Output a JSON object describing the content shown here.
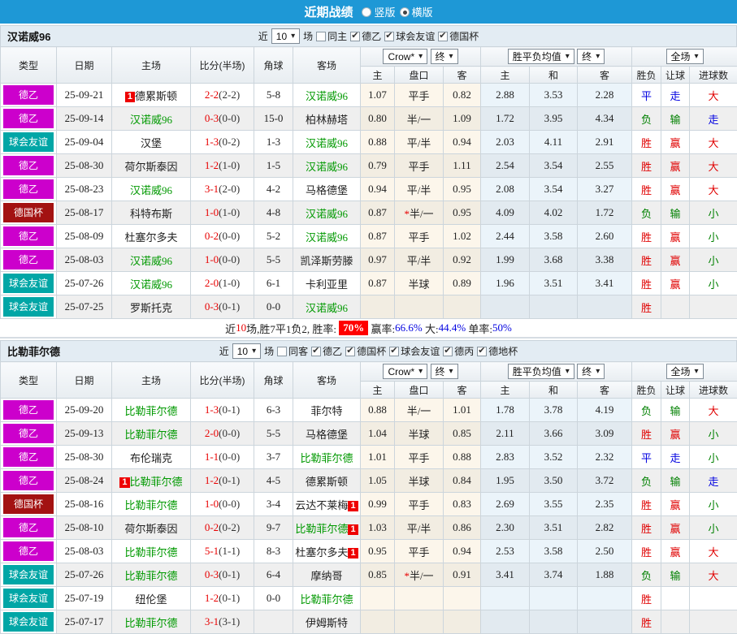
{
  "topbar": {
    "title": "近期战绩",
    "vertical_label": "竖版",
    "horizontal_label": "横版"
  },
  "config": {
    "badge_text": "1"
  },
  "colors": {
    "type_bg": {
      "德乙": "#cc00cc",
      "球会友谊": "#01a6a6",
      "德国杯": "#a31212"
    },
    "result": {
      "胜": "#e00000",
      "赢": "#e00000",
      "大": "#e00000",
      "平": "#0000e0",
      "走": "#0000e0",
      "负": "#008000",
      "输": "#008000",
      "小": "#008000"
    }
  },
  "table_header": {
    "cols": [
      "类型",
      "日期",
      "主场",
      "比分(半场)",
      "角球",
      "客场"
    ],
    "group1_select": "Crow*",
    "group1_final": "终",
    "group1_cols": [
      "主",
      "盘口",
      "客"
    ],
    "group2_select": "胜平负均值",
    "group2_final": "终",
    "group2_cols": [
      "主",
      "和",
      "客"
    ],
    "group3_select": "全场",
    "group3_cols": [
      "胜负",
      "让球",
      "进球数"
    ]
  },
  "sections": [
    {
      "team": "汉诺威96",
      "controls": {
        "prefix": "近",
        "count": "10",
        "suffix": "场",
        "same_label": "同主",
        "same_checked": false,
        "leagues": [
          {
            "label": "德乙",
            "checked": true
          },
          {
            "label": "球会友谊",
            "checked": true
          },
          {
            "label": "德国杯",
            "checked": true
          }
        ]
      },
      "rows": [
        {
          "type": "德乙",
          "date": "25-09-21",
          "home": "德累斯顿",
          "home_focus": false,
          "home_badge": "before",
          "away_badge": "",
          "score": "2-2",
          "half": "(2-2)",
          "corner": "5-8",
          "away": "汉诺威96",
          "away_focus": true,
          "odds": [
            "1.07",
            "平手",
            "0.82"
          ],
          "odds_star": false,
          "avg": [
            "2.88",
            "3.53",
            "2.28"
          ],
          "res": [
            "平",
            "走",
            "大"
          ]
        },
        {
          "type": "德乙",
          "date": "25-09-14",
          "home": "汉诺威96",
          "home_focus": true,
          "home_badge": "",
          "away_badge": "",
          "score": "0-3",
          "half": "(0-0)",
          "corner": "15-0",
          "away": "柏林赫塔",
          "away_focus": false,
          "odds": [
            "0.80",
            "半/一",
            "1.09"
          ],
          "odds_star": false,
          "avg": [
            "1.72",
            "3.95",
            "4.34"
          ],
          "res": [
            "负",
            "输",
            "走"
          ]
        },
        {
          "type": "球会友谊",
          "date": "25-09-04",
          "home": "汉堡",
          "home_focus": false,
          "home_badge": "",
          "away_badge": "",
          "score": "1-3",
          "half": "(0-2)",
          "corner": "1-3",
          "away": "汉诺威96",
          "away_focus": true,
          "odds": [
            "0.88",
            "平/半",
            "0.94"
          ],
          "odds_star": false,
          "avg": [
            "2.03",
            "4.11",
            "2.91"
          ],
          "res": [
            "胜",
            "赢",
            "大"
          ]
        },
        {
          "type": "德乙",
          "date": "25-08-30",
          "home": "荷尔斯泰因",
          "home_focus": false,
          "home_badge": "",
          "away_badge": "",
          "score": "1-2",
          "half": "(1-0)",
          "corner": "1-5",
          "away": "汉诺威96",
          "away_focus": true,
          "odds": [
            "0.79",
            "平手",
            "1.11"
          ],
          "odds_star": false,
          "avg": [
            "2.54",
            "3.54",
            "2.55"
          ],
          "res": [
            "胜",
            "赢",
            "大"
          ]
        },
        {
          "type": "德乙",
          "date": "25-08-23",
          "home": "汉诺威96",
          "home_focus": true,
          "home_badge": "",
          "away_badge": "",
          "score": "3-1",
          "half": "(2-0)",
          "corner": "4-2",
          "away": "马格德堡",
          "away_focus": false,
          "odds": [
            "0.94",
            "平/半",
            "0.95"
          ],
          "odds_star": false,
          "avg": [
            "2.08",
            "3.54",
            "3.27"
          ],
          "res": [
            "胜",
            "赢",
            "大"
          ]
        },
        {
          "type": "德国杯",
          "date": "25-08-17",
          "home": "科特布斯",
          "home_focus": false,
          "home_badge": "",
          "away_badge": "",
          "score": "1-0",
          "half": "(1-0)",
          "corner": "4-8",
          "away": "汉诺威96",
          "away_focus": true,
          "odds": [
            "0.87",
            "半/一",
            "0.95"
          ],
          "odds_star": true,
          "avg": [
            "4.09",
            "4.02",
            "1.72"
          ],
          "res": [
            "负",
            "输",
            "小"
          ]
        },
        {
          "type": "德乙",
          "date": "25-08-09",
          "home": "杜塞尔多夫",
          "home_focus": false,
          "home_badge": "",
          "away_badge": "",
          "score": "0-2",
          "half": "(0-0)",
          "corner": "5-2",
          "away": "汉诺威96",
          "away_focus": true,
          "odds": [
            "0.87",
            "平手",
            "1.02"
          ],
          "odds_star": false,
          "avg": [
            "2.44",
            "3.58",
            "2.60"
          ],
          "res": [
            "胜",
            "赢",
            "小"
          ]
        },
        {
          "type": "德乙",
          "date": "25-08-03",
          "home": "汉诺威96",
          "home_focus": true,
          "home_badge": "",
          "away_badge": "",
          "score": "1-0",
          "half": "(0-0)",
          "corner": "5-5",
          "away": "凯泽斯劳滕",
          "away_focus": false,
          "odds": [
            "0.97",
            "平/半",
            "0.92"
          ],
          "odds_star": false,
          "avg": [
            "1.99",
            "3.68",
            "3.38"
          ],
          "res": [
            "胜",
            "赢",
            "小"
          ]
        },
        {
          "type": "球会友谊",
          "date": "25-07-26",
          "home": "汉诺威96",
          "home_focus": true,
          "home_badge": "",
          "away_badge": "",
          "score": "2-0",
          "half": "(1-0)",
          "corner": "6-1",
          "away": "卡利亚里",
          "away_focus": false,
          "odds": [
            "0.87",
            "半球",
            "0.89"
          ],
          "odds_star": false,
          "avg": [
            "1.96",
            "3.51",
            "3.41"
          ],
          "res": [
            "胜",
            "赢",
            "小"
          ]
        },
        {
          "type": "球会友谊",
          "date": "25-07-25",
          "home": "罗斯托克",
          "home_focus": false,
          "home_badge": "",
          "away_badge": "",
          "score": "0-3",
          "half": "(0-1)",
          "corner": "0-0",
          "away": "汉诺威96",
          "away_focus": true,
          "odds": [
            "",
            "",
            ""
          ],
          "odds_star": false,
          "avg": [
            "",
            "",
            ""
          ],
          "res": [
            "胜",
            "",
            ""
          ]
        }
      ],
      "summary": [
        {
          "text": "近",
          "color": "#222"
        },
        {
          "text": "10",
          "color": "#e80000"
        },
        {
          "text": "场,胜7平1负2, 胜率: ",
          "color": "#222"
        },
        {
          "text": "70%",
          "color": "#ffffff",
          "bg": "#ff0000"
        },
        {
          "text": " 赢率:",
          "color": "#222"
        },
        {
          "text": "66.6%",
          "color": "#0000e0"
        },
        {
          "text": " 大:",
          "color": "#222"
        },
        {
          "text": "44.4%",
          "color": "#0000e0"
        },
        {
          "text": " 单率:",
          "color": "#222"
        },
        {
          "text": "50%",
          "color": "#0000e0"
        }
      ]
    },
    {
      "team": "比勒菲尔德",
      "controls": {
        "prefix": "近",
        "count": "10",
        "suffix": "场",
        "same_label": "同客",
        "same_checked": false,
        "leagues": [
          {
            "label": "德乙",
            "checked": true
          },
          {
            "label": "德国杯",
            "checked": true
          },
          {
            "label": "球会友谊",
            "checked": true
          },
          {
            "label": "德丙",
            "checked": true
          },
          {
            "label": "德地杯",
            "checked": true
          }
        ]
      },
      "rows": [
        {
          "type": "德乙",
          "date": "25-09-20",
          "home": "比勒菲尔德",
          "home_focus": true,
          "home_badge": "",
          "away_badge": "",
          "score": "1-3",
          "half": "(0-1)",
          "corner": "6-3",
          "away": "菲尔特",
          "away_focus": false,
          "odds": [
            "0.88",
            "半/一",
            "1.01"
          ],
          "odds_star": false,
          "avg": [
            "1.78",
            "3.78",
            "4.19"
          ],
          "res": [
            "负",
            "输",
            "大"
          ]
        },
        {
          "type": "德乙",
          "date": "25-09-13",
          "home": "比勒菲尔德",
          "home_focus": true,
          "home_badge": "",
          "away_badge": "",
          "score": "2-0",
          "half": "(0-0)",
          "corner": "5-5",
          "away": "马格德堡",
          "away_focus": false,
          "odds": [
            "1.04",
            "半球",
            "0.85"
          ],
          "odds_star": false,
          "avg": [
            "2.11",
            "3.66",
            "3.09"
          ],
          "res": [
            "胜",
            "赢",
            "小"
          ]
        },
        {
          "type": "德乙",
          "date": "25-08-30",
          "home": "布伦瑞克",
          "home_focus": false,
          "home_badge": "",
          "away_badge": "",
          "score": "1-1",
          "half": "(0-0)",
          "corner": "3-7",
          "away": "比勒菲尔德",
          "away_focus": true,
          "odds": [
            "1.01",
            "平手",
            "0.88"
          ],
          "odds_star": false,
          "avg": [
            "2.83",
            "3.52",
            "2.32"
          ],
          "res": [
            "平",
            "走",
            "小"
          ]
        },
        {
          "type": "德乙",
          "date": "25-08-24",
          "home": "比勒菲尔德",
          "home_focus": true,
          "home_badge": "before",
          "away_badge": "",
          "score": "1-2",
          "half": "(0-1)",
          "corner": "4-5",
          "away": "德累斯顿",
          "away_focus": false,
          "odds": [
            "1.05",
            "半球",
            "0.84"
          ],
          "odds_star": false,
          "avg": [
            "1.95",
            "3.50",
            "3.72"
          ],
          "res": [
            "负",
            "输",
            "走"
          ]
        },
        {
          "type": "德国杯",
          "date": "25-08-16",
          "home": "比勒菲尔德",
          "home_focus": true,
          "home_badge": "",
          "away_badge": "after",
          "score": "1-0",
          "half": "(0-0)",
          "corner": "3-4",
          "away": "云达不莱梅",
          "away_focus": false,
          "odds": [
            "0.99",
            "平手",
            "0.83"
          ],
          "odds_star": false,
          "avg": [
            "2.69",
            "3.55",
            "2.35"
          ],
          "res": [
            "胜",
            "赢",
            "小"
          ]
        },
        {
          "type": "德乙",
          "date": "25-08-10",
          "home": "荷尔斯泰因",
          "home_focus": false,
          "home_badge": "",
          "away_badge": "after",
          "score": "0-2",
          "half": "(0-2)",
          "corner": "9-7",
          "away": "比勒菲尔德",
          "away_focus": true,
          "odds": [
            "1.03",
            "平/半",
            "0.86"
          ],
          "odds_star": false,
          "avg": [
            "2.30",
            "3.51",
            "2.82"
          ],
          "res": [
            "胜",
            "赢",
            "小"
          ]
        },
        {
          "type": "德乙",
          "date": "25-08-03",
          "home": "比勒菲尔德",
          "home_focus": true,
          "home_badge": "",
          "away_badge": "after",
          "score": "5-1",
          "half": "(1-1)",
          "corner": "8-3",
          "away": "杜塞尔多夫",
          "away_focus": false,
          "odds": [
            "0.95",
            "平手",
            "0.94"
          ],
          "odds_star": false,
          "avg": [
            "2.53",
            "3.58",
            "2.50"
          ],
          "res": [
            "胜",
            "赢",
            "大"
          ]
        },
        {
          "type": "球会友谊",
          "date": "25-07-26",
          "home": "比勒菲尔德",
          "home_focus": true,
          "home_badge": "",
          "away_badge": "",
          "score": "0-3",
          "half": "(0-1)",
          "corner": "6-4",
          "away": "摩纳哥",
          "away_focus": false,
          "odds": [
            "0.85",
            "半/一",
            "0.91"
          ],
          "odds_star": true,
          "avg": [
            "3.41",
            "3.74",
            "1.88"
          ],
          "res": [
            "负",
            "输",
            "大"
          ]
        },
        {
          "type": "球会友谊",
          "date": "25-07-19",
          "home": "纽伦堡",
          "home_focus": false,
          "home_badge": "",
          "away_badge": "",
          "score": "1-2",
          "half": "(0-1)",
          "corner": "0-0",
          "away": "比勒菲尔德",
          "away_focus": true,
          "odds": [
            "",
            "",
            ""
          ],
          "odds_star": false,
          "avg": [
            "",
            "",
            ""
          ],
          "res": [
            "胜",
            "",
            ""
          ]
        },
        {
          "type": "球会友谊",
          "date": "25-07-17",
          "home": "比勒菲尔德",
          "home_focus": true,
          "home_badge": "",
          "away_badge": "",
          "score": "3-1",
          "half": "(3-1)",
          "corner": "",
          "away": "伊姆斯特",
          "away_focus": false,
          "odds": [
            "",
            "",
            ""
          ],
          "odds_star": false,
          "avg": [
            "",
            "",
            ""
          ],
          "res": [
            "胜",
            "",
            ""
          ]
        }
      ],
      "summary": []
    }
  ]
}
